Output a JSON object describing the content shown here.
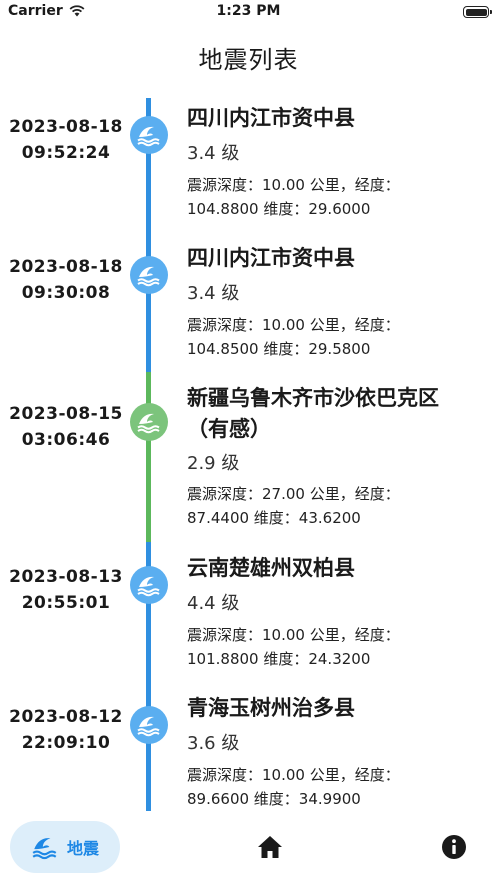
{
  "status_bar": {
    "carrier": "Carrier",
    "time": "1:23 PM"
  },
  "page_title": "地震列表",
  "colors": {
    "blue": "#2f8fe0",
    "green": "#5cb85c",
    "node_blue": "#5aaef0",
    "node_green": "#7cc47c"
  },
  "entries": [
    {
      "date": "2023-08-18",
      "time": "09:52:24",
      "place": "四川内江市资中县",
      "magnitude": "3.4 级",
      "detail_line1": "震源深度：10.00 公里，经度：",
      "detail_line2": "104.8800 维度：29.6000",
      "status_color": "blue"
    },
    {
      "date": "2023-08-18",
      "time": "09:30:08",
      "place": "四川内江市资中县",
      "magnitude": "3.4 级",
      "detail_line1": "震源深度：10.00 公里，经度：",
      "detail_line2": "104.8500 维度：29.5800",
      "status_color": "blue"
    },
    {
      "date": "2023-08-15",
      "time": "03:06:46",
      "place": "新疆乌鲁木齐市沙依巴克区",
      "place_line2": "（有感）",
      "magnitude": "2.9 级",
      "detail_line1": "震源深度：27.00 公里，经度：",
      "detail_line2": "87.4400 维度：43.6200",
      "status_color": "green"
    },
    {
      "date": "2023-08-13",
      "time": "20:55:01",
      "place": "云南楚雄州双柏县",
      "magnitude": "4.4 级",
      "detail_line1": "震源深度：10.00 公里，经度：",
      "detail_line2": "101.8800 维度：24.3200",
      "status_color": "blue"
    },
    {
      "date": "2023-08-12",
      "time": "22:09:10",
      "place": "青海玉树州治多县",
      "magnitude": "3.6 级",
      "detail_line1": "震源深度：10.00 公里，经度：",
      "detail_line2": "89.6600 维度：34.9900",
      "status_color": "blue"
    }
  ],
  "tab_bar": {
    "tabs": [
      {
        "label": "地震",
        "icon": "wave-icon",
        "active": true
      },
      {
        "icon": "home-icon"
      },
      {
        "icon": "info-icon"
      }
    ]
  }
}
